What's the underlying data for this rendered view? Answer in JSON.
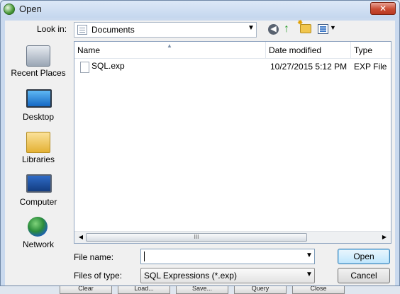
{
  "window": {
    "title": "Open"
  },
  "toolbar": {
    "lookin_label": "Look in:",
    "lookin_value": "Documents",
    "icons": [
      "back-icon",
      "up-folder-icon",
      "new-folder-icon",
      "views-menu-icon"
    ]
  },
  "places": [
    {
      "label": "Recent Places",
      "icon": "recent-places-icon"
    },
    {
      "label": "Desktop",
      "icon": "desktop-icon"
    },
    {
      "label": "Libraries",
      "icon": "libraries-icon"
    },
    {
      "label": "Computer",
      "icon": "computer-icon"
    },
    {
      "label": "Network",
      "icon": "network-icon"
    }
  ],
  "filelist": {
    "columns": [
      "Name",
      "Date modified",
      "Type"
    ],
    "rows": [
      {
        "name": "SQL.exp",
        "date": "10/27/2015 5:12 PM",
        "type": "EXP File"
      }
    ],
    "scroll_grip": "III"
  },
  "filename": {
    "label": "File name:",
    "value": ""
  },
  "filetype": {
    "label": "Files of type:",
    "value": "SQL Expressions (*.exp)"
  },
  "buttons": {
    "open": "Open",
    "cancel": "Cancel"
  },
  "background_buttons": [
    "Clear",
    "Load...",
    "Save...",
    "Query",
    "Close"
  ]
}
